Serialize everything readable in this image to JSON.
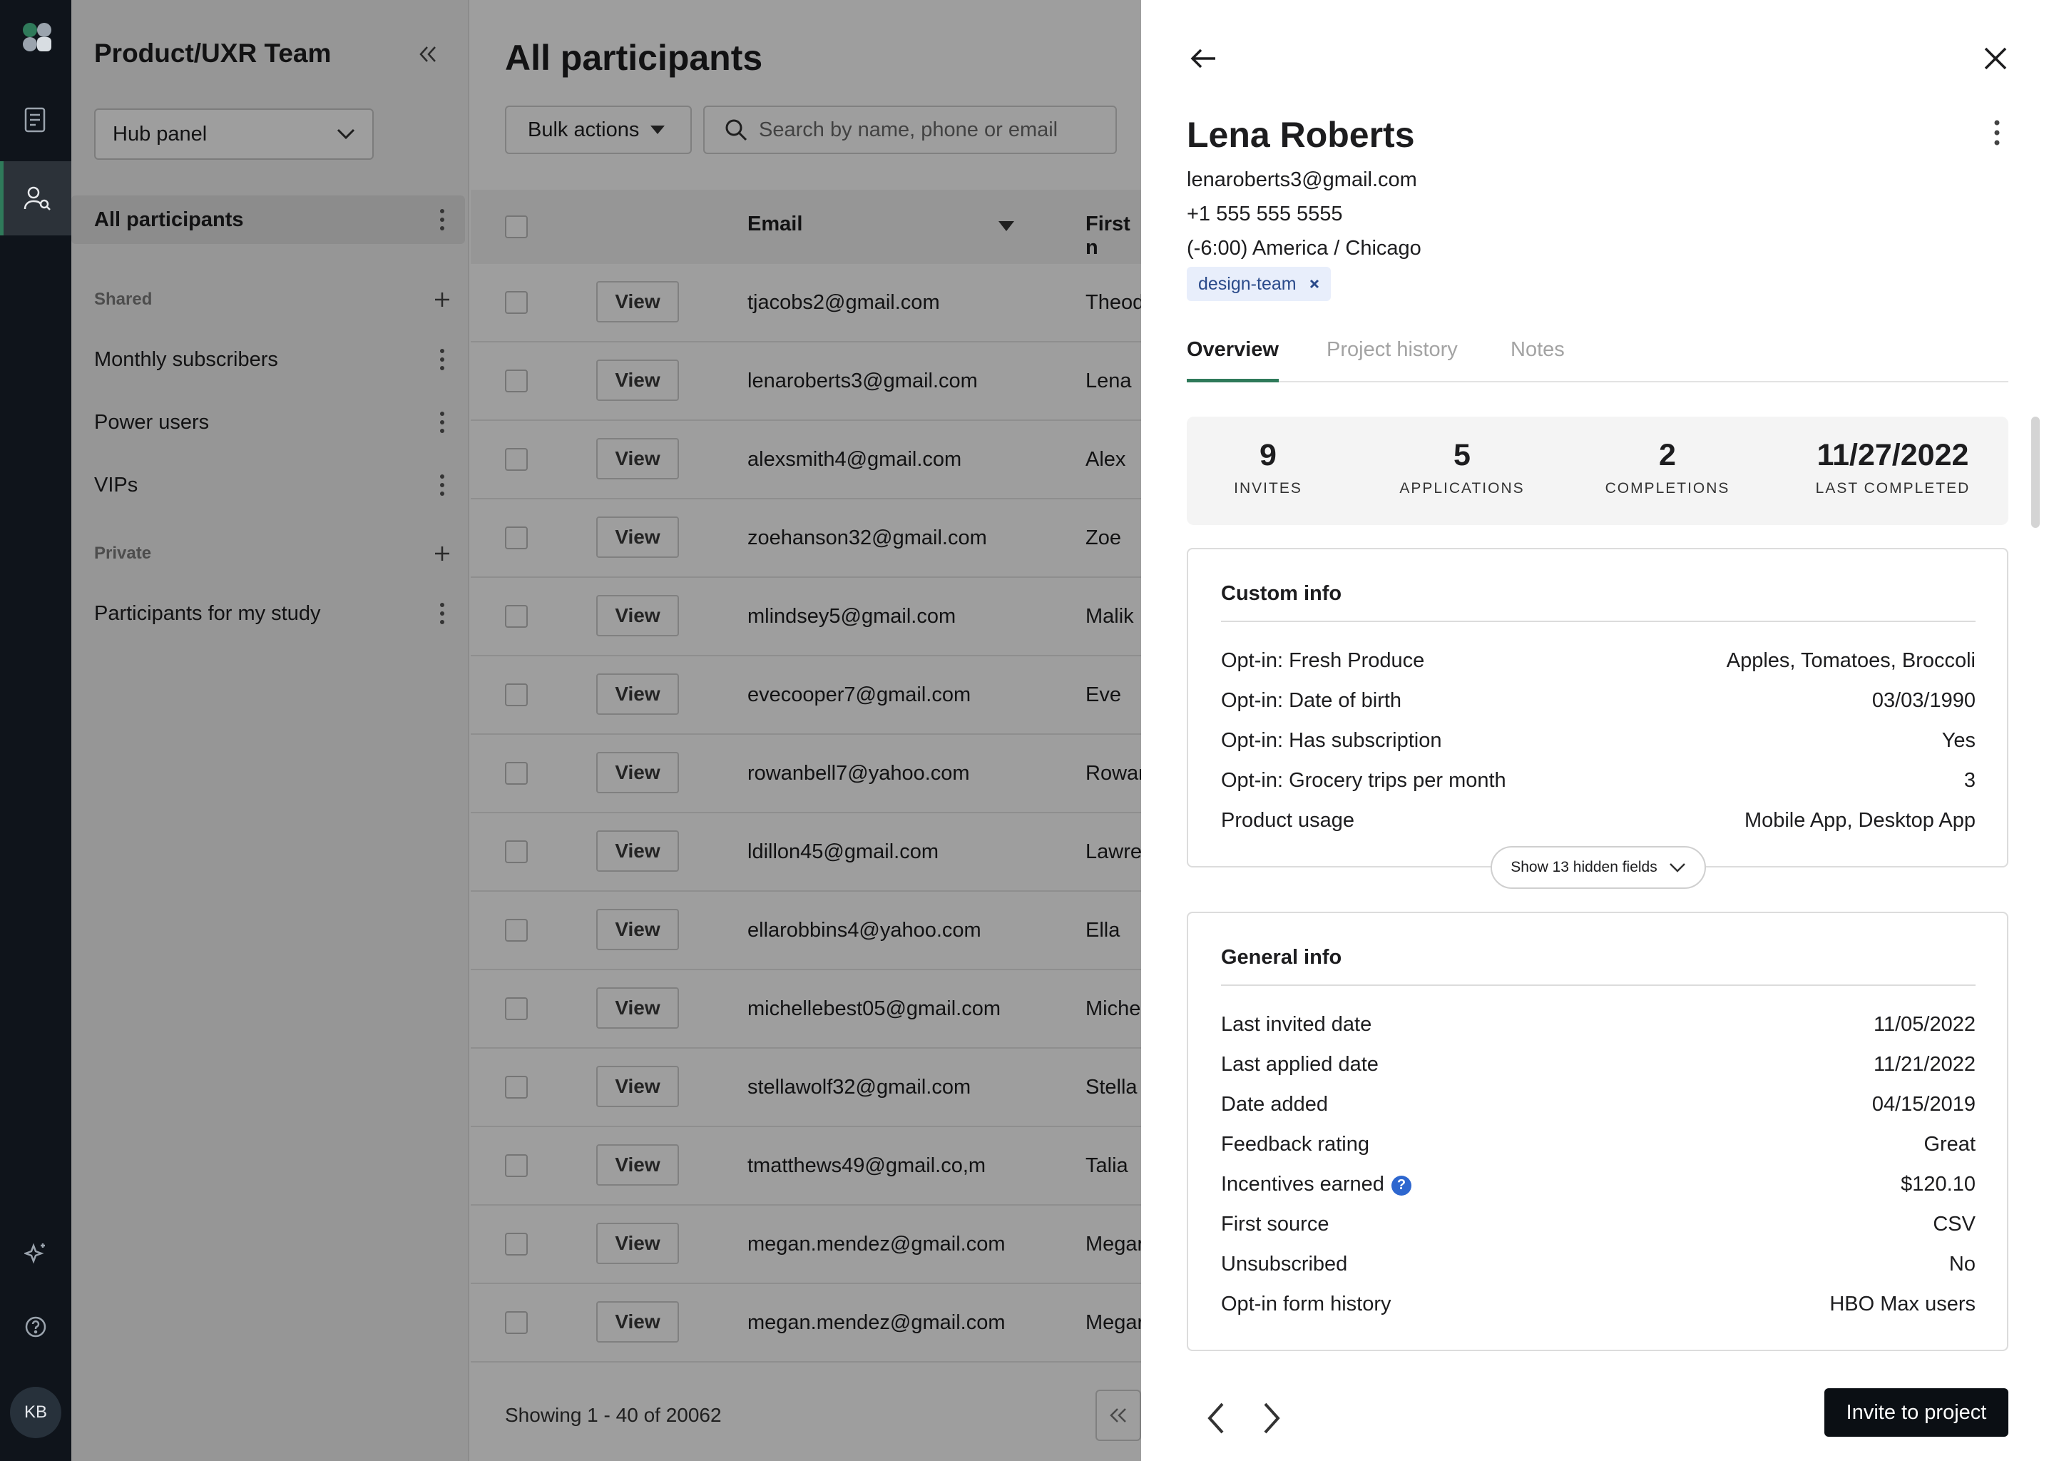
{
  "rail": {
    "items": [
      {
        "icon": "document-icon"
      },
      {
        "icon": "participants-search-icon",
        "active": true
      }
    ],
    "bottom": [
      {
        "icon": "sparkle-icon"
      },
      {
        "icon": "help-icon"
      }
    ],
    "avatar": "KB"
  },
  "side": {
    "title": "Product/UXR Team",
    "hub_select": "Hub panel",
    "all_participants": "All participants",
    "shared_label": "Shared",
    "shared_items": [
      "Monthly subscribers",
      "Power users",
      "VIPs"
    ],
    "private_label": "Private",
    "private_items": [
      "Participants for my study"
    ]
  },
  "main": {
    "title": "All participants",
    "bulk_actions": "Bulk actions",
    "search_placeholder": "Search by name, phone or email",
    "columns": {
      "email": "Email",
      "first": "First n"
    },
    "view_label": "View",
    "rows": [
      {
        "email": "tjacobs2@gmail.com",
        "first": "Theod"
      },
      {
        "email": "lenaroberts3@gmail.com",
        "first": "Lena"
      },
      {
        "email": "alexsmith4@gmail.com",
        "first": "Alex"
      },
      {
        "email": "zoehanson32@gmail.com",
        "first": "Zoe"
      },
      {
        "email": "mlindsey5@gmail.com",
        "first": "Malik"
      },
      {
        "email": "evecooper7@gmail.com",
        "first": "Eve"
      },
      {
        "email": "rowanbell7@yahoo.com",
        "first": "Rowar"
      },
      {
        "email": "ldillon45@gmail.com",
        "first": "Lawre"
      },
      {
        "email": "ellarobbins4@yahoo.com",
        "first": "Ella"
      },
      {
        "email": "michellebest05@gmail.com",
        "first": "Miche"
      },
      {
        "email": "stellawolf32@gmail.com",
        "first": "Stella"
      },
      {
        "email": "tmatthews49@gmail.co,m",
        "first": "Talia"
      },
      {
        "email": "megan.mendez@gmail.com",
        "first": "Megar"
      },
      {
        "email": "megan.mendez@gmail.com",
        "first": "Megar"
      }
    ],
    "showing": "Showing 1 - 40 of 20062"
  },
  "drawer": {
    "name": "Lena Roberts",
    "email": "lenaroberts3@gmail.com",
    "phone": "+1 555 555 5555",
    "timezone": "(-6:00) America / Chicago",
    "tag": "design-team",
    "tabs": [
      "Overview",
      "Project history",
      "Notes"
    ],
    "stats": [
      {
        "value": "9",
        "label": "INVITES"
      },
      {
        "value": "5",
        "label": "APPLICATIONS"
      },
      {
        "value": "2",
        "label": "COMPLETIONS"
      },
      {
        "value": "11/27/2022",
        "label": "LAST COMPLETED"
      }
    ],
    "custom_info": {
      "title": "Custom info",
      "fields": [
        {
          "label": "Opt-in: Fresh Produce",
          "value": "Apples, Tomatoes, Broccoli"
        },
        {
          "label": "Opt-in: Date of birth",
          "value": "03/03/1990"
        },
        {
          "label": "Opt-in: Has subscription",
          "value": "Yes"
        },
        {
          "label": "Opt-in: Grocery trips per month",
          "value": "3"
        },
        {
          "label": "Product usage",
          "value": "Mobile App, Desktop App"
        }
      ],
      "show_hidden": "Show 13 hidden fields"
    },
    "general_info": {
      "title": "General info",
      "fields": [
        {
          "label": "Last invited date",
          "value": "11/05/2022"
        },
        {
          "label": "Last applied date",
          "value": "11/21/2022"
        },
        {
          "label": "Date added",
          "value": "04/15/2019"
        },
        {
          "label": "Feedback rating",
          "value": "Great"
        },
        {
          "label": "Incentives earned",
          "value": "$120.10"
        },
        {
          "label": "First source",
          "value": "CSV"
        },
        {
          "label": "Unsubscribed",
          "value": "No"
        },
        {
          "label": "Opt-in form history",
          "value": "HBO Max users"
        }
      ]
    },
    "invite_button": "Invite to project"
  },
  "colors": {
    "accent": "#2f7a5a",
    "rail": "#0f141b",
    "help": "#2e67cf"
  }
}
